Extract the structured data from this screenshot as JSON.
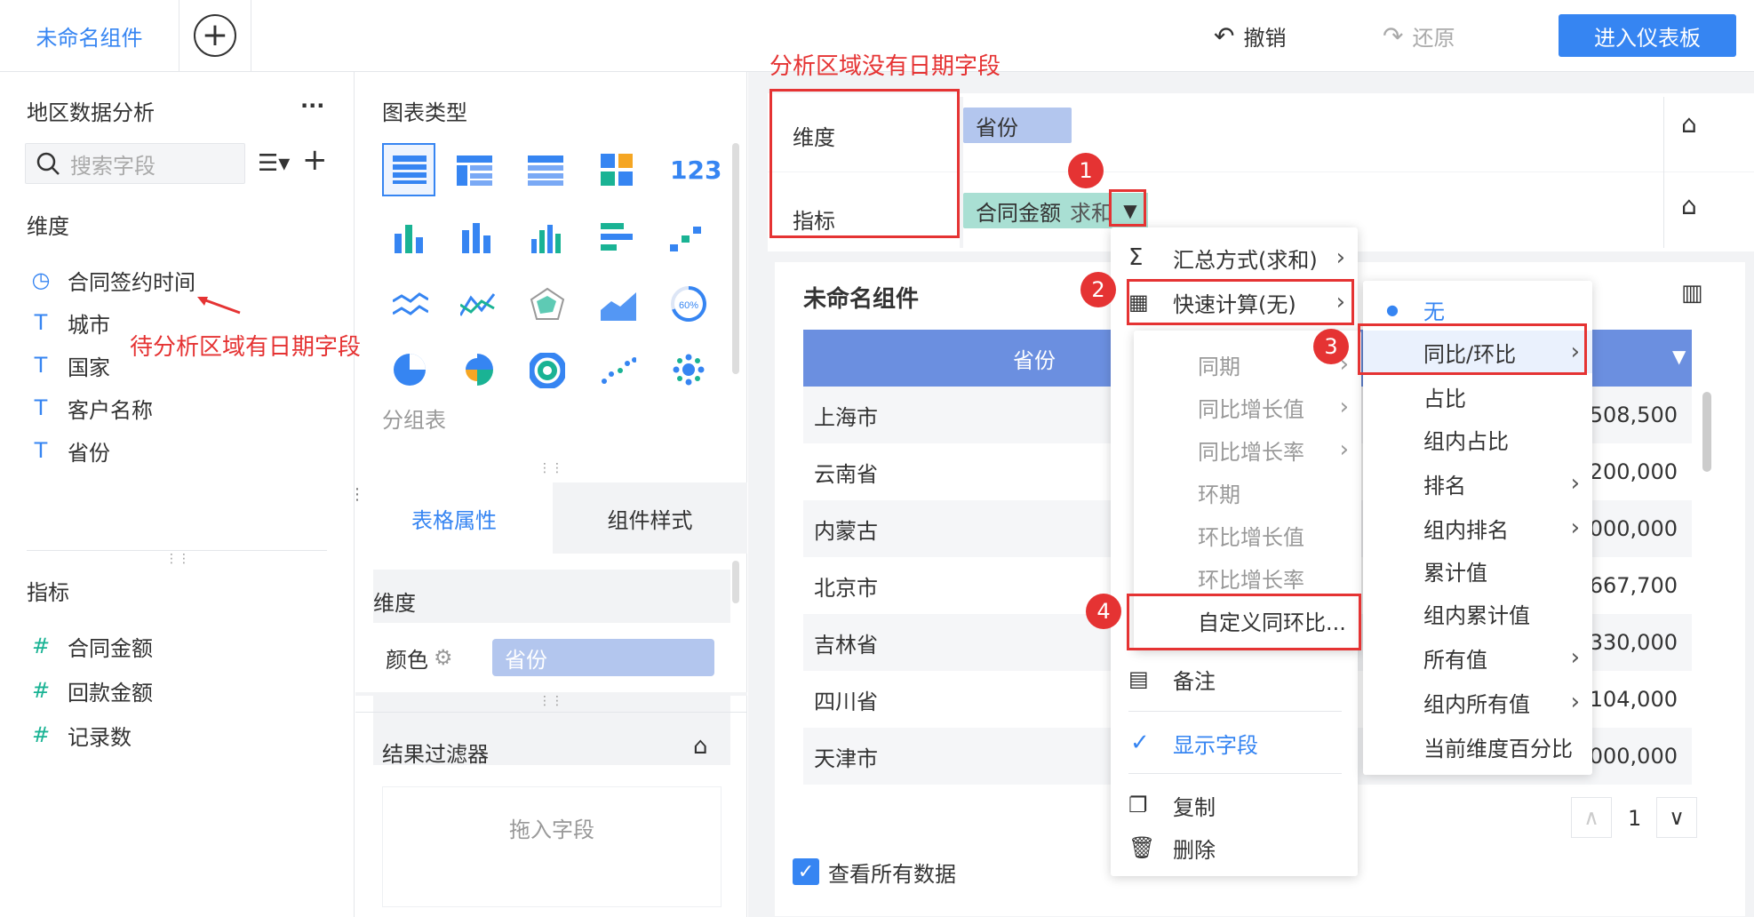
{
  "topbar": {
    "tab_title": "未命名组件",
    "add_tab": "+",
    "undo": "撤销",
    "redo": "还原",
    "enter_dashboard": "进入仪表板"
  },
  "left_panel": {
    "title": "地区数据分析",
    "more": "···",
    "search_placeholder": "搜索字段",
    "dim_header": "维度",
    "dimensions": [
      {
        "icon": "clock-icon",
        "label": "合同签约时间"
      },
      {
        "icon": "text-type-icon",
        "label": "城市"
      },
      {
        "icon": "text-type-icon",
        "label": "国家"
      },
      {
        "icon": "text-type-icon",
        "label": "客户名称"
      },
      {
        "icon": "text-type-icon",
        "label": "省份"
      }
    ],
    "metric_header": "指标",
    "metrics": [
      {
        "icon": "number-type-icon",
        "label": "合同金额"
      },
      {
        "icon": "number-type-icon",
        "label": "回款金额"
      },
      {
        "icon": "number-type-icon",
        "label": "记录数"
      }
    ]
  },
  "middle_panel": {
    "chart_types_title": "图表类型",
    "selected_chart_name": "分组表",
    "tabs": {
      "table_props": "表格属性",
      "component_style": "组件样式"
    },
    "dim_label": "维度",
    "color_label": "颜色",
    "color_field": "省份",
    "filter_title": "结果过滤器",
    "drop_placeholder": "拖入字段"
  },
  "right_panel": {
    "dimension_label": "维度",
    "dimension_field": "省份",
    "metric_label": "指标",
    "metric_field": "合同金额",
    "metric_agg": "求和",
    "component_title": "未命名组件",
    "table_header": "省份",
    "rows": [
      {
        "name": "上海市",
        "value": "34,508,500"
      },
      {
        "name": "云南省",
        "value": "30,200,000"
      },
      {
        "name": "内蒙古",
        "value": "10,000,000"
      },
      {
        "name": "北京市",
        "value": "20,667,700"
      },
      {
        "name": "吉林省",
        "value": "1,330,000"
      },
      {
        "name": "四川省",
        "value": "38,104,000"
      },
      {
        "name": "天津市",
        "value": "6,000,000"
      }
    ],
    "page_number": "1",
    "view_all": "查看所有数据"
  },
  "menu_main": {
    "summary": "汇总方式(求和)",
    "quick_calc": "快速计算(无)",
    "note": "备注",
    "show_field": "显示字段",
    "copy": "复制",
    "delete": "删除"
  },
  "menu_yoy": {
    "items": [
      "同期",
      "同比增长值",
      "同比增长率",
      "环期",
      "环比增长值",
      "环比增长率"
    ],
    "custom": "自定义同环比..."
  },
  "menu_quick": {
    "items": [
      {
        "label": "无",
        "selected": true
      },
      {
        "label": "同比/环比",
        "arrow": true
      },
      {
        "label": "占比"
      },
      {
        "label": "组内占比"
      },
      {
        "label": "排名",
        "arrow": true
      },
      {
        "label": "组内排名",
        "arrow": true
      },
      {
        "label": "累计值"
      },
      {
        "label": "组内累计值"
      },
      {
        "label": "所有值",
        "arrow": true
      },
      {
        "label": "组内所有值",
        "arrow": true
      },
      {
        "label": "当前维度百分比"
      }
    ]
  },
  "annotations": {
    "no_date_note": "分析区域没有日期字段",
    "has_date_note": "待分析区域有日期字段",
    "steps": [
      "1",
      "2",
      "3",
      "4"
    ]
  },
  "colors": {
    "accent": "#3685f2",
    "annotation_red": "#e53333",
    "teal": "#1ab394",
    "table_header_bg": "#6b8fe0"
  }
}
